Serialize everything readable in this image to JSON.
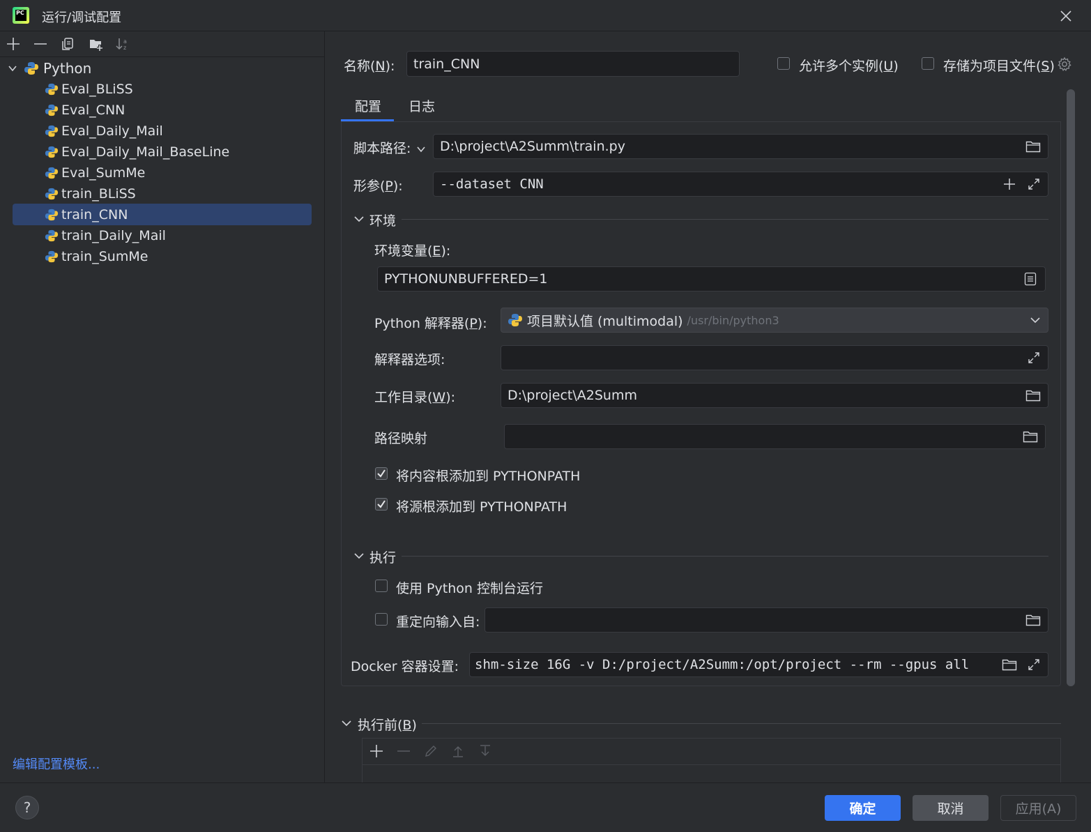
{
  "window": {
    "title": "运行/调试配置",
    "logo_text": "PC"
  },
  "tree": {
    "group_label": "Python",
    "items": [
      {
        "label": "Eval_BLiSS"
      },
      {
        "label": "Eval_CNN"
      },
      {
        "label": "Eval_Daily_Mail"
      },
      {
        "label": "Eval_Daily_Mail_BaseLine"
      },
      {
        "label": "Eval_SumMe"
      },
      {
        "label": "train_BLiSS"
      },
      {
        "label": "train_CNN"
      },
      {
        "label": "train_Daily_Mail"
      },
      {
        "label": "train_SumMe"
      }
    ],
    "selected": "train_CNN"
  },
  "edit_templates_link": "编辑配置模板...",
  "name": {
    "label": "名称(N):",
    "value": "train_CNN"
  },
  "allow_multiple": {
    "label": "允许多个实例(U)",
    "checked": false
  },
  "store_as_file": {
    "label": "存储为项目文件(S)",
    "checked": false
  },
  "tabs": [
    {
      "label": "配置"
    },
    {
      "label": "日志"
    }
  ],
  "active_tab": "配置",
  "script_path": {
    "label": "脚本路径:",
    "value": "D:\\project\\A2Summ\\train.py"
  },
  "params": {
    "label": "形参(P):",
    "value": "--dataset CNN"
  },
  "env_section": {
    "label": "环境"
  },
  "env_vars": {
    "label": "环境变量(E):",
    "value": "PYTHONUNBUFFERED=1"
  },
  "interpreter": {
    "label": "Python 解释器(P):",
    "value": "项目默认值 (multimodal)",
    "path": "/usr/bin/python3"
  },
  "interp_options": {
    "label": "解释器选项:",
    "value": ""
  },
  "workdir": {
    "label": "工作目录(W):",
    "value": "D:\\project\\A2Summ"
  },
  "path_mapping": {
    "label": "路径映射",
    "value": ""
  },
  "add_content_roots": {
    "label": "将内容根添加到 PYTHONPATH",
    "checked": true
  },
  "add_source_roots": {
    "label": "将源根添加到 PYTHONPATH",
    "checked": true
  },
  "exec_section": {
    "label": "执行"
  },
  "use_console": {
    "label": "使用 Python 控制台运行",
    "checked": false
  },
  "redirect_input": {
    "label": "重定向输入自:",
    "checked": false,
    "value": ""
  },
  "docker": {
    "label": "Docker 容器设置:",
    "value": "shm-size 16G -v D:/project/A2Summ:/opt/project --rm --gpus all"
  },
  "before_launch": {
    "label": "执行前(B)"
  },
  "buttons": {
    "ok": "确定",
    "cancel": "取消",
    "apply": "应用(A)",
    "help": "?"
  },
  "colors": {
    "accent": "#3574f0",
    "selection": "#2e436e",
    "background": "#2b2d30",
    "field": "#1e1f22"
  }
}
